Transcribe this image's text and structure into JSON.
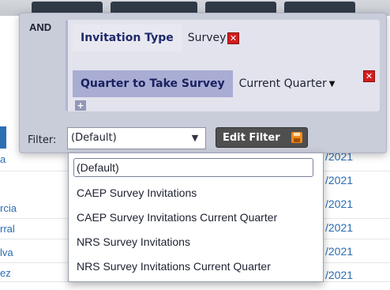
{
  "background": {
    "row_names": [
      "a",
      "rcia",
      "rral",
      "lva",
      "ez"
    ],
    "row_dates": [
      "/2021",
      "/2021",
      "/2021",
      "/2021",
      "/2021",
      "/2021"
    ]
  },
  "filter_builder": {
    "operator": "AND",
    "conditions": [
      {
        "field": "Invitation Type",
        "value": "Survey",
        "remove": "✕"
      },
      {
        "field": "Quarter to Take Survey",
        "value": "Current Quarter",
        "remove": "✕"
      }
    ],
    "add_label": "+",
    "caret": "▼"
  },
  "filter_bar": {
    "label": "Filter:",
    "selected": "(Default)",
    "arrow": "▼",
    "edit_button_label": "Edit Filter",
    "edit_icon": "save-icon"
  },
  "dropdown": {
    "options": [
      "(Default)",
      "CAEP Survey Invitations",
      "CAEP Survey Invitations Current Quarter",
      "NRS Survey Invitations",
      "NRS Survey Invitations Current Quarter"
    ],
    "selected_option": "(Default)"
  },
  "colors": {
    "panel": "#c9ccd9",
    "group": "#e2e3ed",
    "selected_field": "#a9acd3",
    "remove": "#d21d1d",
    "edit_button": "#4f4f4f",
    "link_text": "#2a6cb0"
  }
}
